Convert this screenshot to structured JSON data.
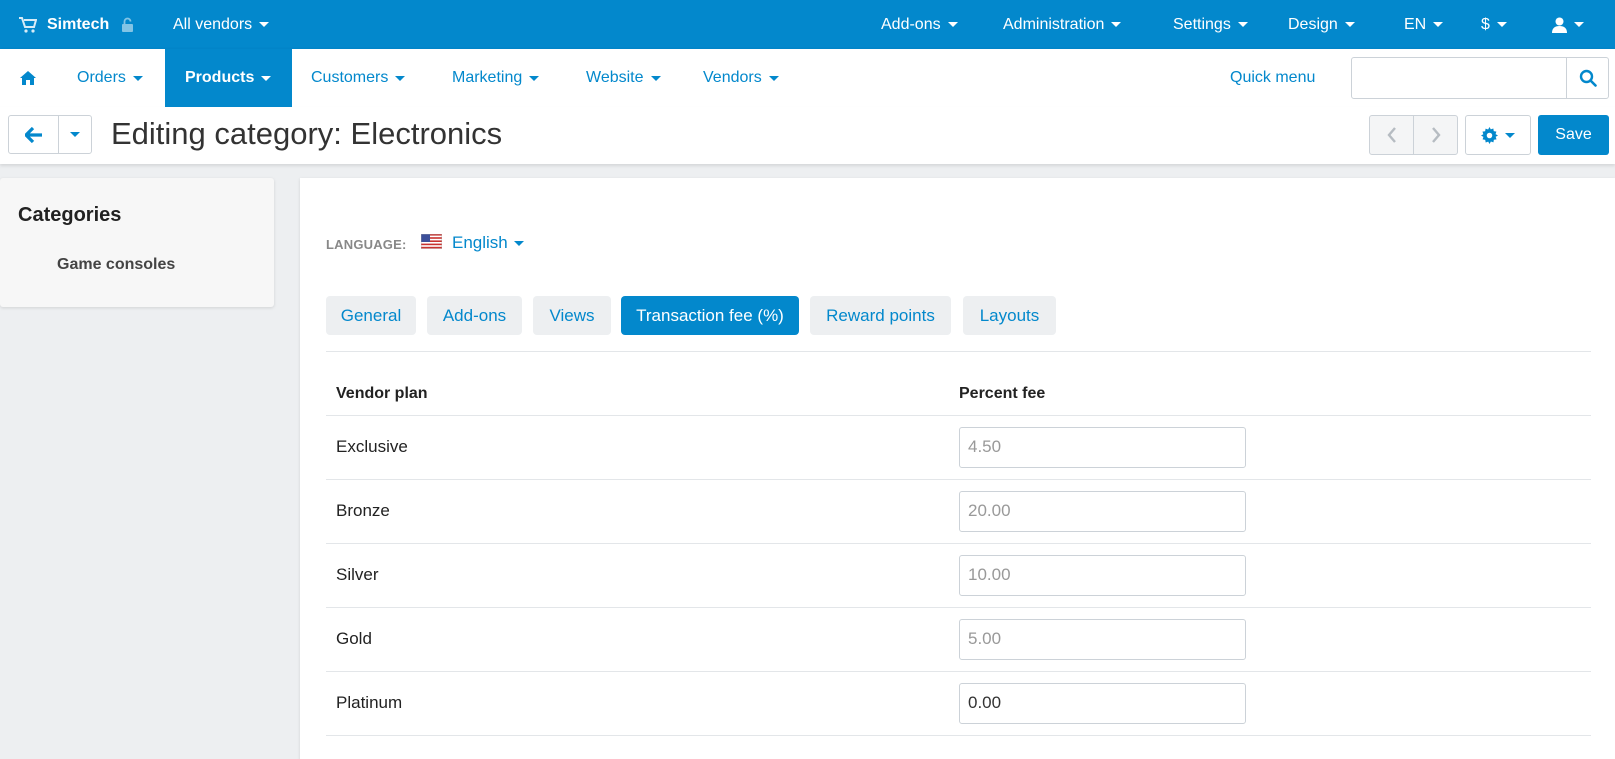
{
  "topbar": {
    "brand": "Simtech",
    "vendor_selector": "All vendors",
    "menus": [
      "Add-ons",
      "Administration",
      "Settings",
      "Design",
      "EN",
      "$"
    ],
    "icons": {
      "cart": "cart-icon",
      "lock": "lock-icon",
      "user": "user-icon"
    }
  },
  "mainnav": {
    "items": [
      "Orders",
      "Products",
      "Customers",
      "Marketing",
      "Website",
      "Vendors"
    ],
    "active": "Products",
    "quick_menu": "Quick menu",
    "search": {
      "value": "",
      "placeholder": ""
    }
  },
  "header": {
    "title": "Editing category: Electronics",
    "save_label": "Save"
  },
  "sidebar": {
    "title": "Categories",
    "items": [
      "Game consoles"
    ]
  },
  "content": {
    "language_label": "LANGUAGE:",
    "language_value": "English",
    "tabs": [
      "General",
      "Add-ons",
      "Views",
      "Transaction fee (%)",
      "Reward points",
      "Layouts"
    ],
    "active_tab": "Transaction fee (%)",
    "table": {
      "headers": [
        "Vendor plan",
        "Percent fee"
      ],
      "rows": [
        {
          "plan": "Exclusive",
          "value": "",
          "placeholder": "4.50"
        },
        {
          "plan": "Bronze",
          "value": "",
          "placeholder": "20.00"
        },
        {
          "plan": "Silver",
          "value": "",
          "placeholder": "10.00"
        },
        {
          "plan": "Gold",
          "value": "",
          "placeholder": "5.00"
        },
        {
          "plan": "Platinum",
          "value": "0.00",
          "placeholder": ""
        }
      ]
    }
  },
  "colors": {
    "accent": "#0388cc",
    "background": "#edeff1"
  }
}
